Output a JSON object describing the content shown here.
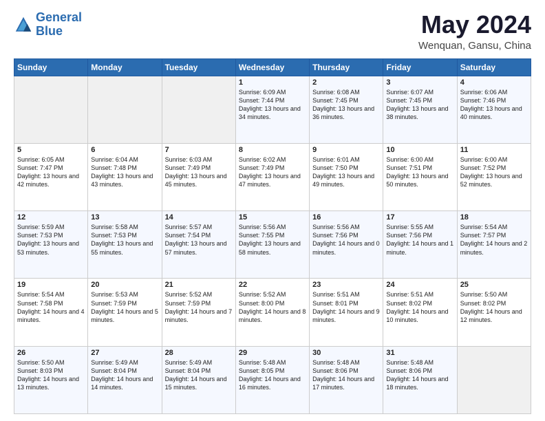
{
  "logo": {
    "line1": "General",
    "line2": "Blue"
  },
  "title": "May 2024",
  "location": "Wenquan, Gansu, China",
  "weekdays": [
    "Sunday",
    "Monday",
    "Tuesday",
    "Wednesday",
    "Thursday",
    "Friday",
    "Saturday"
  ],
  "weeks": [
    [
      {
        "day": "",
        "text": ""
      },
      {
        "day": "",
        "text": ""
      },
      {
        "day": "",
        "text": ""
      },
      {
        "day": "1",
        "text": "Sunrise: 6:09 AM\nSunset: 7:44 PM\nDaylight: 13 hours\nand 34 minutes."
      },
      {
        "day": "2",
        "text": "Sunrise: 6:08 AM\nSunset: 7:45 PM\nDaylight: 13 hours\nand 36 minutes."
      },
      {
        "day": "3",
        "text": "Sunrise: 6:07 AM\nSunset: 7:45 PM\nDaylight: 13 hours\nand 38 minutes."
      },
      {
        "day": "4",
        "text": "Sunrise: 6:06 AM\nSunset: 7:46 PM\nDaylight: 13 hours\nand 40 minutes."
      }
    ],
    [
      {
        "day": "5",
        "text": "Sunrise: 6:05 AM\nSunset: 7:47 PM\nDaylight: 13 hours\nand 42 minutes."
      },
      {
        "day": "6",
        "text": "Sunrise: 6:04 AM\nSunset: 7:48 PM\nDaylight: 13 hours\nand 43 minutes."
      },
      {
        "day": "7",
        "text": "Sunrise: 6:03 AM\nSunset: 7:49 PM\nDaylight: 13 hours\nand 45 minutes."
      },
      {
        "day": "8",
        "text": "Sunrise: 6:02 AM\nSunset: 7:49 PM\nDaylight: 13 hours\nand 47 minutes."
      },
      {
        "day": "9",
        "text": "Sunrise: 6:01 AM\nSunset: 7:50 PM\nDaylight: 13 hours\nand 49 minutes."
      },
      {
        "day": "10",
        "text": "Sunrise: 6:00 AM\nSunset: 7:51 PM\nDaylight: 13 hours\nand 50 minutes."
      },
      {
        "day": "11",
        "text": "Sunrise: 6:00 AM\nSunset: 7:52 PM\nDaylight: 13 hours\nand 52 minutes."
      }
    ],
    [
      {
        "day": "12",
        "text": "Sunrise: 5:59 AM\nSunset: 7:53 PM\nDaylight: 13 hours\nand 53 minutes."
      },
      {
        "day": "13",
        "text": "Sunrise: 5:58 AM\nSunset: 7:53 PM\nDaylight: 13 hours\nand 55 minutes."
      },
      {
        "day": "14",
        "text": "Sunrise: 5:57 AM\nSunset: 7:54 PM\nDaylight: 13 hours\nand 57 minutes."
      },
      {
        "day": "15",
        "text": "Sunrise: 5:56 AM\nSunset: 7:55 PM\nDaylight: 13 hours\nand 58 minutes."
      },
      {
        "day": "16",
        "text": "Sunrise: 5:56 AM\nSunset: 7:56 PM\nDaylight: 14 hours\nand 0 minutes."
      },
      {
        "day": "17",
        "text": "Sunrise: 5:55 AM\nSunset: 7:56 PM\nDaylight: 14 hours\nand 1 minute."
      },
      {
        "day": "18",
        "text": "Sunrise: 5:54 AM\nSunset: 7:57 PM\nDaylight: 14 hours\nand 2 minutes."
      }
    ],
    [
      {
        "day": "19",
        "text": "Sunrise: 5:54 AM\nSunset: 7:58 PM\nDaylight: 14 hours\nand 4 minutes."
      },
      {
        "day": "20",
        "text": "Sunrise: 5:53 AM\nSunset: 7:59 PM\nDaylight: 14 hours\nand 5 minutes."
      },
      {
        "day": "21",
        "text": "Sunrise: 5:52 AM\nSunset: 7:59 PM\nDaylight: 14 hours\nand 7 minutes."
      },
      {
        "day": "22",
        "text": "Sunrise: 5:52 AM\nSunset: 8:00 PM\nDaylight: 14 hours\nand 8 minutes."
      },
      {
        "day": "23",
        "text": "Sunrise: 5:51 AM\nSunset: 8:01 PM\nDaylight: 14 hours\nand 9 minutes."
      },
      {
        "day": "24",
        "text": "Sunrise: 5:51 AM\nSunset: 8:02 PM\nDaylight: 14 hours\nand 10 minutes."
      },
      {
        "day": "25",
        "text": "Sunrise: 5:50 AM\nSunset: 8:02 PM\nDaylight: 14 hours\nand 12 minutes."
      }
    ],
    [
      {
        "day": "26",
        "text": "Sunrise: 5:50 AM\nSunset: 8:03 PM\nDaylight: 14 hours\nand 13 minutes."
      },
      {
        "day": "27",
        "text": "Sunrise: 5:49 AM\nSunset: 8:04 PM\nDaylight: 14 hours\nand 14 minutes."
      },
      {
        "day": "28",
        "text": "Sunrise: 5:49 AM\nSunset: 8:04 PM\nDaylight: 14 hours\nand 15 minutes."
      },
      {
        "day": "29",
        "text": "Sunrise: 5:48 AM\nSunset: 8:05 PM\nDaylight: 14 hours\nand 16 minutes."
      },
      {
        "day": "30",
        "text": "Sunrise: 5:48 AM\nSunset: 8:06 PM\nDaylight: 14 hours\nand 17 minutes."
      },
      {
        "day": "31",
        "text": "Sunrise: 5:48 AM\nSunset: 8:06 PM\nDaylight: 14 hours\nand 18 minutes."
      },
      {
        "day": "",
        "text": ""
      }
    ]
  ]
}
